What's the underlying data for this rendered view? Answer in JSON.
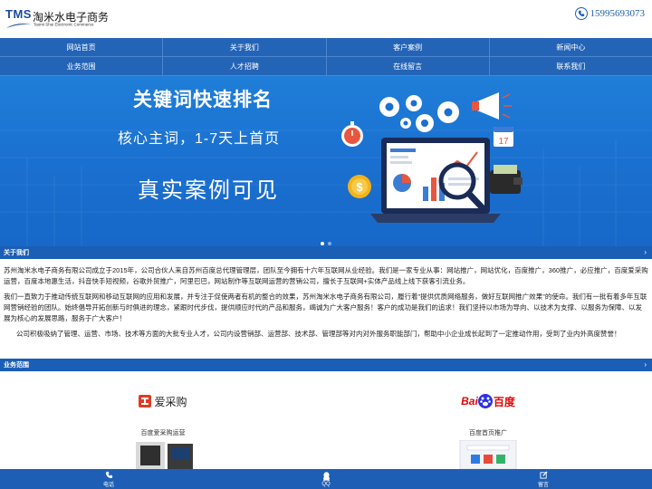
{
  "header": {
    "logo_mark": "TMS",
    "logo_cn": "淘米水电子商务",
    "logo_en": "Taomi Shui Electronic Commerce",
    "phone": "15995693073"
  },
  "nav": {
    "row1": [
      "网站首页",
      "关于我们",
      "客户案例",
      "新闻中心"
    ],
    "row2": [
      "业务范围",
      "人才招聘",
      "在线留言",
      "联系我们"
    ]
  },
  "banner": {
    "line1": "关键词快速排名",
    "line2": "核心主词，1-7天上首页",
    "line3": "真实案例可见",
    "calendar_day": "17",
    "coin_symbol": "$",
    "active_slide": 1,
    "slide_count": 2
  },
  "about": {
    "title": "关于我们",
    "paragraph1": "苏州淘米水电子商务有限公司成立于2015年，公司合伙人来自苏州百度总代理管理层，团队至今拥有十六年互联网从业经验。我们是一家专业从事：网站推广，网站优化，百度推广，360推广，必应推广，百度爱采购运营，百度本地惠生活，抖音快手短视频，谷歌外贸推广，阿里巴巴，网站制作等互联网运营的营销公司，擅长于互联网+实体产品线上线下获客引流业务。",
    "paragraph2": "我们一直致力于推动传统互联网和移动互联网的应用和发展，并专注于促使两者有机的整合的效果，苏州淘米水电子商务有限公司，履行着\"提供优质网络服务，做好互联网推广效果\"的使命。我们有一批有着多年互联网营销经验的团队。始终倡导开拓创新与时俱进的理念，紧跟时代步伐，提供顺应时代的产品和服务，竭诚为广大客户服务！客户的成功是我们的追求！我们坚持以市场为导向、以技术为支撑、以服务为保障、以发展为核心的发展思路，服务于广大客户！",
    "paragraph3": "公司积极吸纳了管理、运营、市场、技术等方面的大批专业人才，公司内设营销部、运营部、技术部、管理部等对内对外服务职能部门，帮助中小企业成长起到了一定推动作用，受到了业内外高度赞誉！"
  },
  "services": {
    "title": "业务范围",
    "items": [
      {
        "logo_text": "爱采购",
        "caption": "百度爱采购运营"
      },
      {
        "logo_text": "百度",
        "caption": "百度首页推广"
      }
    ]
  },
  "bottom_bar": {
    "items": [
      {
        "label": "电话",
        "icon": "phone-icon"
      },
      {
        "label": "QQ",
        "icon": "qq-icon"
      },
      {
        "label": "留言",
        "icon": "edit-icon"
      }
    ]
  },
  "colors": {
    "brand_blue": "#2464b7",
    "section_blue": "#1b5eb5",
    "banner_blue": "#1a6fcf",
    "baidu_red": "#e10602",
    "baidu_blue": "#2932e1"
  }
}
